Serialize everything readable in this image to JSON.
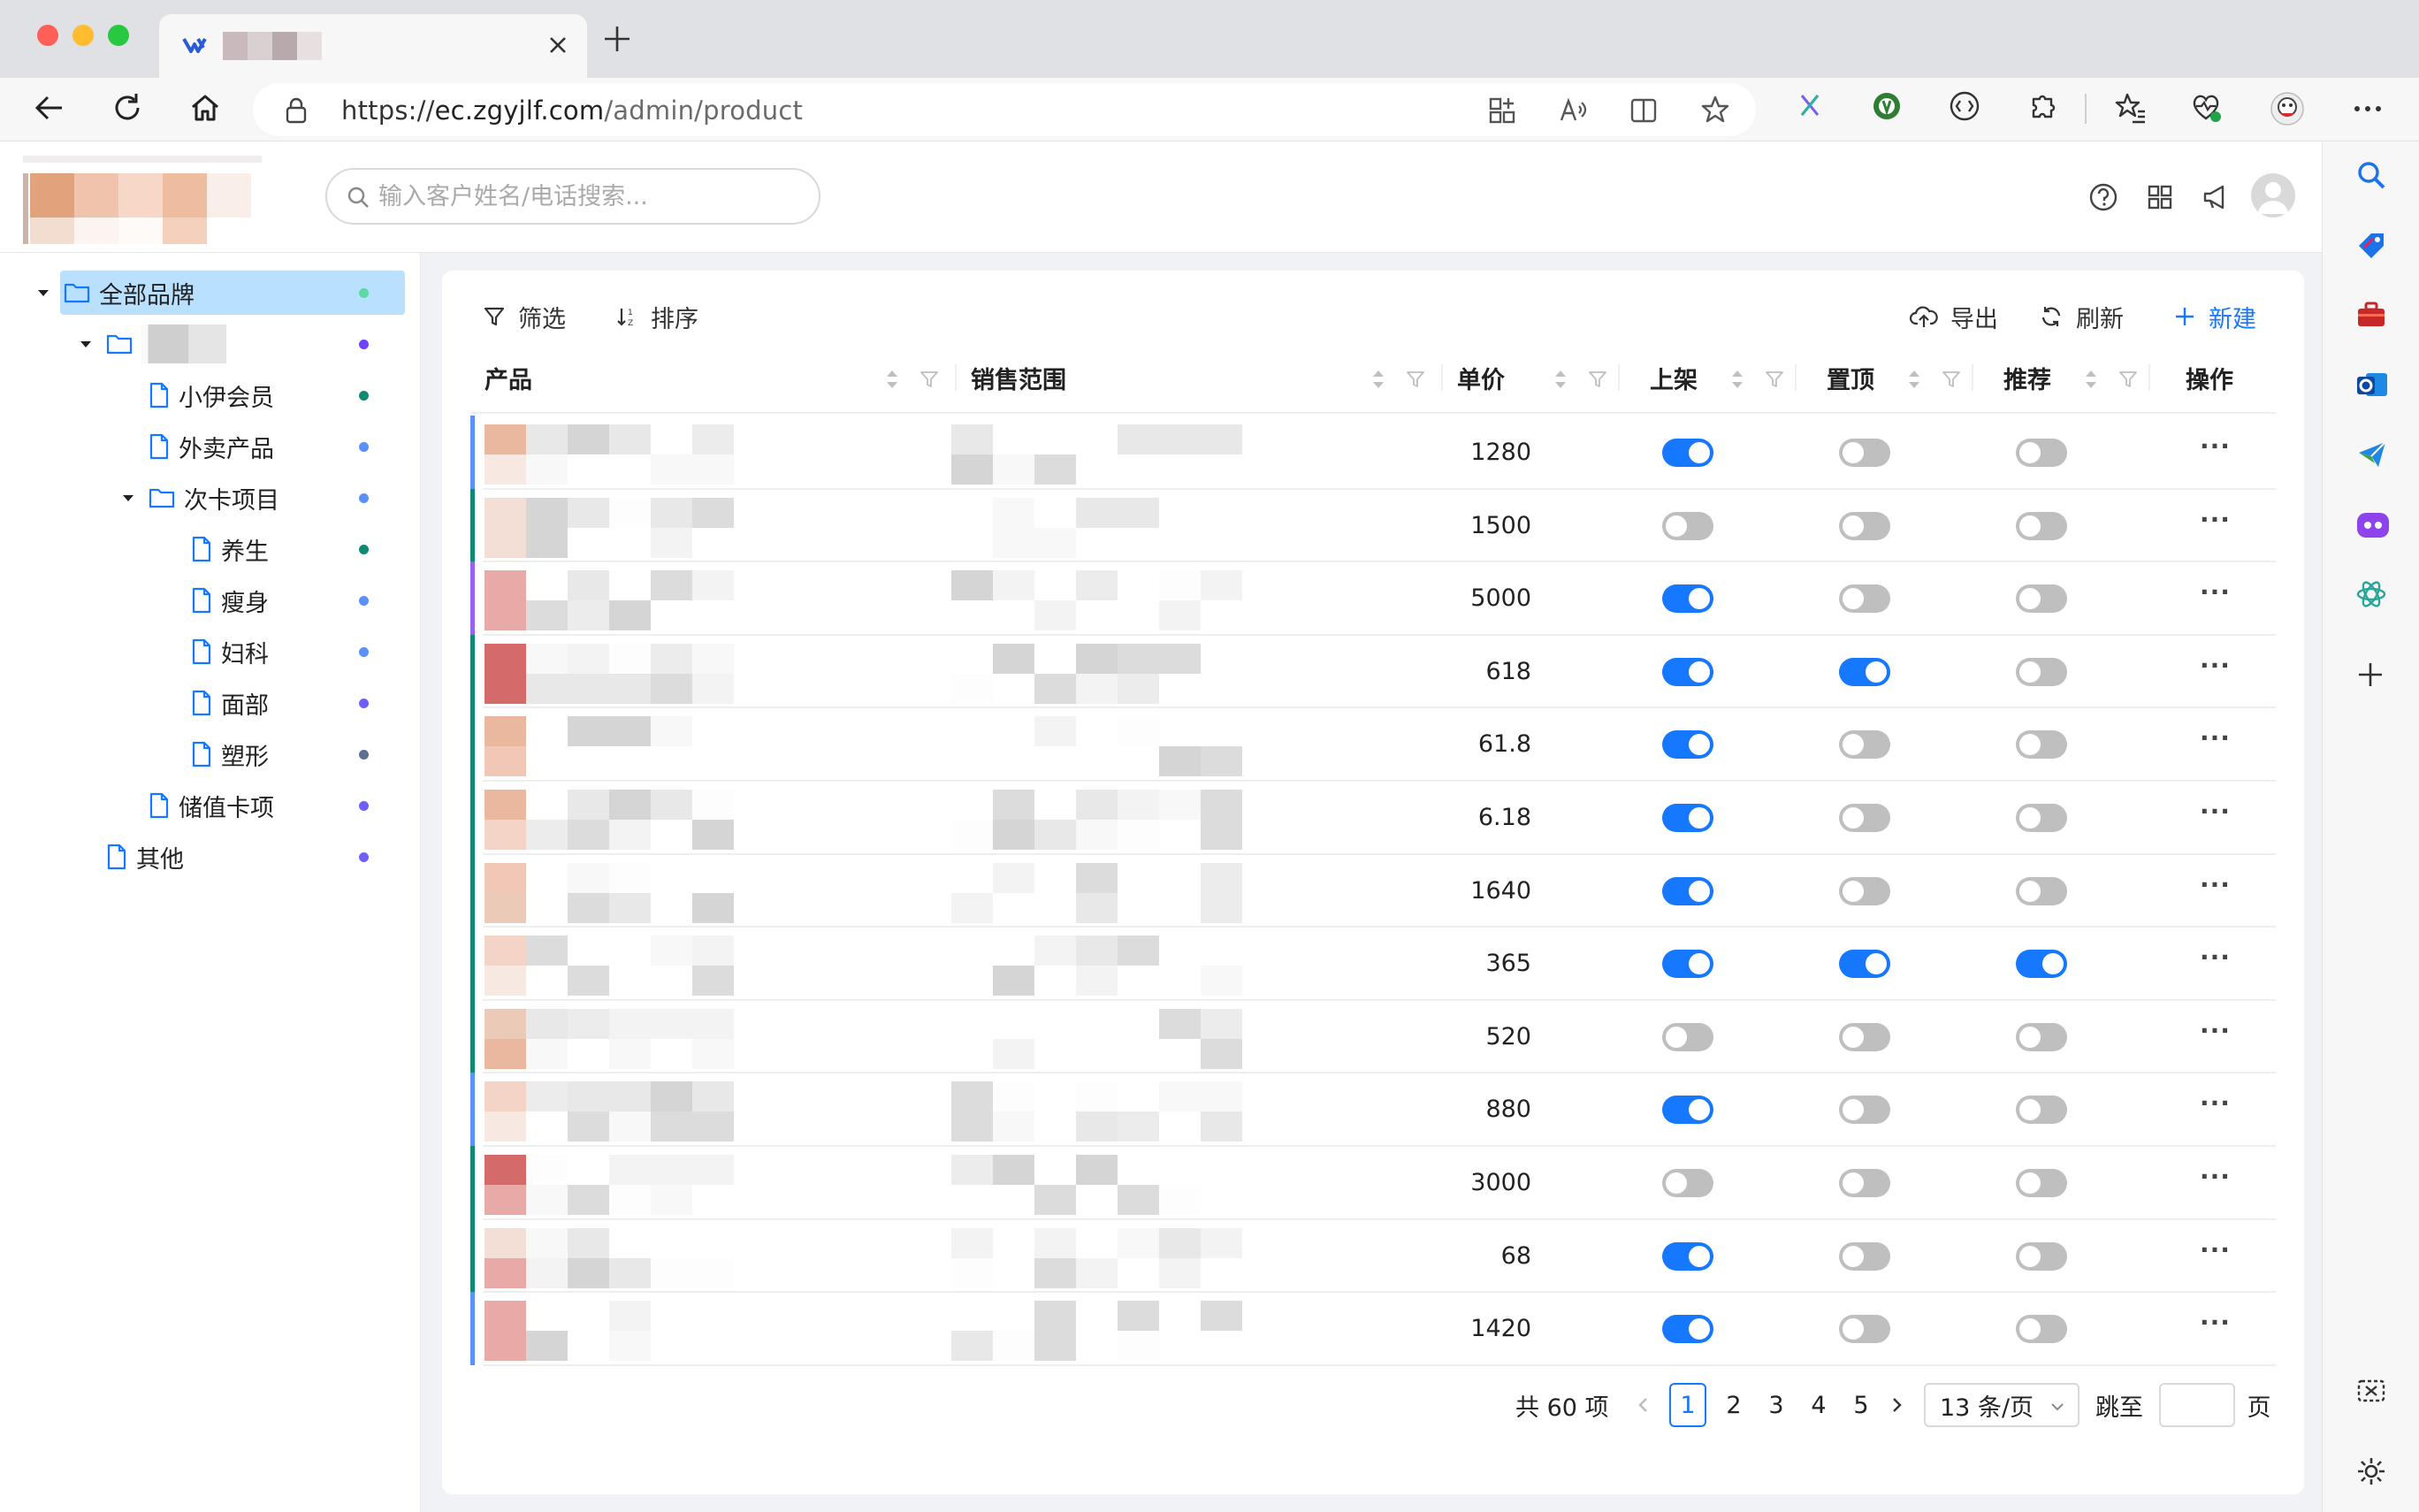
{
  "browser": {
    "tab_title": "",
    "url_scheme": "https://",
    "url_host": "ec.zgyjlf.com",
    "url_path": "/admin/product"
  },
  "header": {
    "search_placeholder": "输入客户姓名/电话搜索..."
  },
  "tree": {
    "items": [
      {
        "label": "全部品牌",
        "level": 0,
        "type": "folder",
        "expanded": true,
        "selected": true,
        "dot": "#5ad8a6"
      },
      {
        "label": "",
        "level": 1,
        "type": "folder",
        "expanded": true,
        "dot": "#6f42ff"
      },
      {
        "label": "小伊会员",
        "level": 2,
        "type": "file",
        "dot": "#0e8a72"
      },
      {
        "label": "外卖产品",
        "level": 2,
        "type": "file",
        "dot": "#5b8ff9"
      },
      {
        "label": "次卡项目",
        "level": 2,
        "type": "folder",
        "expanded": true,
        "dot": "#5b8ff9"
      },
      {
        "label": "养生",
        "level": 3,
        "type": "file",
        "dot": "#0e8a72"
      },
      {
        "label": "瘦身",
        "level": 3,
        "type": "file",
        "dot": "#5b8ff9"
      },
      {
        "label": "妇科",
        "level": 3,
        "type": "file",
        "dot": "#5b8ff9"
      },
      {
        "label": "面部",
        "level": 3,
        "type": "file",
        "dot": "#6f5ef9"
      },
      {
        "label": "塑形",
        "level": 3,
        "type": "file",
        "dot": "#5d7092"
      },
      {
        "label": "储值卡项",
        "level": 2,
        "type": "file",
        "dot": "#6f5ef9"
      },
      {
        "label": "其他",
        "level": 1,
        "type": "file",
        "dot": "#6f5ef9"
      }
    ]
  },
  "toolbar": {
    "filter_label": "筛选",
    "sort_label": "排序",
    "export_label": "导出",
    "refresh_label": "刷新",
    "new_label": "新建"
  },
  "table": {
    "columns": {
      "product": "产品",
      "sales_range": "销售范围",
      "price": "单价",
      "on_shelf": "上架",
      "pin_top": "置顶",
      "recommend": "推荐",
      "actions": "操作"
    },
    "more_label": "···",
    "rows": [
      {
        "price": "1280",
        "on_shelf": true,
        "pin_top": false,
        "recommend": false,
        "bar": "#5b8ff9"
      },
      {
        "price": "1500",
        "on_shelf": false,
        "pin_top": false,
        "recommend": false,
        "bar": "#0e8a72"
      },
      {
        "price": "5000",
        "on_shelf": true,
        "pin_top": false,
        "recommend": false,
        "bar": "#9661f5"
      },
      {
        "price": "618",
        "on_shelf": true,
        "pin_top": true,
        "recommend": false,
        "bar": "#0e8a72"
      },
      {
        "price": "61.8",
        "on_shelf": true,
        "pin_top": false,
        "recommend": false,
        "bar": "#0e8a72"
      },
      {
        "price": "6.18",
        "on_shelf": true,
        "pin_top": false,
        "recommend": false,
        "bar": "#0e8a72"
      },
      {
        "price": "1640",
        "on_shelf": true,
        "pin_top": false,
        "recommend": false,
        "bar": "#0e8a72"
      },
      {
        "price": "365",
        "on_shelf": true,
        "pin_top": true,
        "recommend": true,
        "bar": "#0e8a72"
      },
      {
        "price": "520",
        "on_shelf": false,
        "pin_top": false,
        "recommend": false,
        "bar": "#0e8a72"
      },
      {
        "price": "880",
        "on_shelf": true,
        "pin_top": false,
        "recommend": false,
        "bar": "#5b8ff9"
      },
      {
        "price": "3000",
        "on_shelf": false,
        "pin_top": false,
        "recommend": false,
        "bar": "#0e8a72"
      },
      {
        "price": "68",
        "on_shelf": true,
        "pin_top": false,
        "recommend": false,
        "bar": "#0e8a72"
      },
      {
        "price": "1420",
        "on_shelf": true,
        "pin_top": false,
        "recommend": false,
        "bar": "#5b8ff9"
      }
    ]
  },
  "pagination": {
    "total_label": "共 60 项",
    "pages": [
      "1",
      "2",
      "3",
      "4",
      "5"
    ],
    "current_page": "1",
    "page_size_label": "13 条/页",
    "jump_label": "跳至",
    "page_suffix": "页"
  },
  "colors": {
    "accent": "#1677ff",
    "selected_bg": "#bae0ff",
    "toggle_off": "#bfbfbf"
  }
}
